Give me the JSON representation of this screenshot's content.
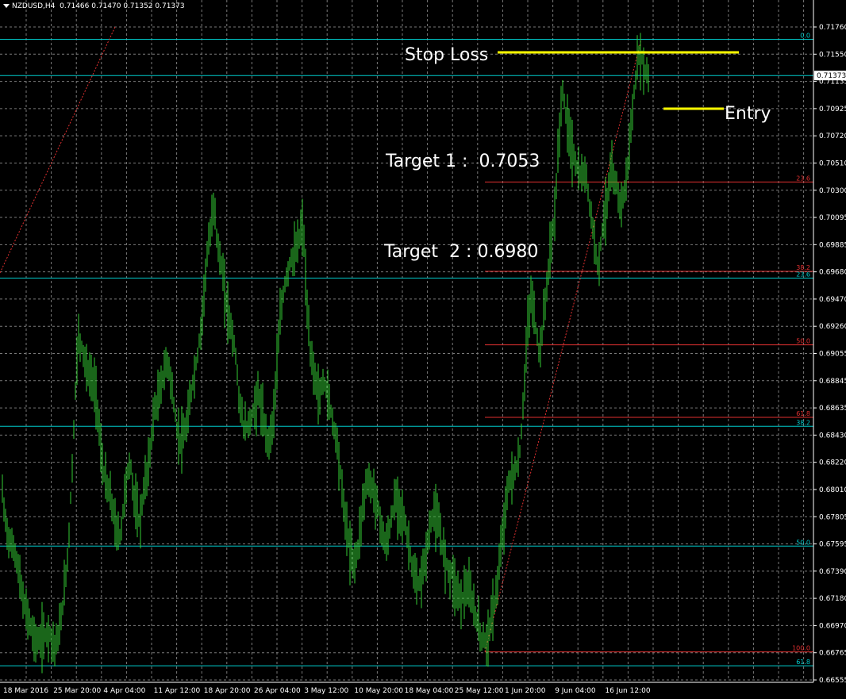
{
  "window": {
    "symbol_label": "NZDUSD,H4",
    "ohlc_label": "0.71466 0.71470 0.71352 0.71373"
  },
  "colors": {
    "background": "#000000",
    "grid": "#7a7a7a",
    "candles": "#33cc33",
    "axis_text": "#ffffff",
    "fib_cyan": "#00cccc",
    "fib_red": "#e03030",
    "annotation_yellow": "#ffff00",
    "current_price_box": "#ffffff"
  },
  "chart_data": {
    "type": "candlestick",
    "symbol": "NZDUSD",
    "timeframe": "H4",
    "last": {
      "open": 0.71466,
      "high": 0.7147,
      "low": 0.71352,
      "close": 0.71373
    },
    "ylim": [
      0.66555,
      0.71865
    ],
    "y_ticks": [
      "0.71760",
      "0.71550",
      "0.71373",
      "0.71135",
      "0.70925",
      "0.70720",
      "0.70510",
      "0.70300",
      "0.70095",
      "0.69885",
      "0.69680",
      "0.69470",
      "0.69260",
      "0.69055",
      "0.68845",
      "0.68635",
      "0.68430",
      "0.68220",
      "0.68010",
      "0.67805",
      "0.67595",
      "0.67390",
      "0.67180",
      "0.66970",
      "0.66765",
      "0.66555"
    ],
    "x_ticks": [
      "18 Mar 2016",
      "25 Mar 20:00",
      "4 Apr 04:00",
      "11 Apr 12:00",
      "18 Apr 20:00",
      "26 Apr 04:00",
      "3 May 12:00",
      "10 May 20:00",
      "18 May 04:00",
      "25 May 12:00",
      "1 Jun 20:00",
      "9 Jun 04:00",
      "16 Jun 12:00"
    ],
    "price_path": [
      [
        0,
        0.6825
      ],
      [
        6,
        0.6785
      ],
      [
        12,
        0.6765
      ],
      [
        18,
        0.676
      ],
      [
        24,
        0.674
      ],
      [
        30,
        0.6715
      ],
      [
        36,
        0.6705
      ],
      [
        42,
        0.669
      ],
      [
        48,
        0.6685
      ],
      [
        55,
        0.669
      ],
      [
        62,
        0.6695
      ],
      [
        68,
        0.6682
      ],
      [
        74,
        0.669
      ],
      [
        80,
        0.672
      ],
      [
        86,
        0.676
      ],
      [
        92,
        0.684
      ],
      [
        98,
        0.693
      ],
      [
        104,
        0.692
      ],
      [
        110,
        0.69
      ],
      [
        116,
        0.6895
      ],
      [
        122,
        0.688
      ],
      [
        128,
        0.683
      ],
      [
        134,
        0.681
      ],
      [
        140,
        0.68
      ],
      [
        146,
        0.6775
      ],
      [
        152,
        0.677
      ],
      [
        158,
        0.681
      ],
      [
        164,
        0.683
      ],
      [
        170,
        0.6795
      ],
      [
        176,
        0.678
      ],
      [
        182,
        0.681
      ],
      [
        188,
        0.683
      ],
      [
        194,
        0.687
      ],
      [
        200,
        0.688
      ],
      [
        206,
        0.69
      ],
      [
        212,
        0.691
      ],
      [
        218,
        0.688
      ],
      [
        224,
        0.685
      ],
      [
        230,
        0.6845
      ],
      [
        236,
        0.686
      ],
      [
        242,
        0.689
      ],
      [
        248,
        0.691
      ],
      [
        254,
        0.694
      ],
      [
        260,
        0.699
      ],
      [
        266,
        0.7015
      ],
      [
        270,
        0.704
      ],
      [
        274,
        0.7
      ],
      [
        278,
        0.699
      ],
      [
        284,
        0.696
      ],
      [
        290,
        0.694
      ],
      [
        296,
        0.692
      ],
      [
        302,
        0.6875
      ],
      [
        308,
        0.6855
      ],
      [
        314,
        0.686
      ],
      [
        320,
        0.687
      ],
      [
        326,
        0.6885
      ],
      [
        332,
        0.686
      ],
      [
        338,
        0.6845
      ],
      [
        344,
        0.686
      ],
      [
        348,
        0.69
      ],
      [
        354,
        0.695
      ],
      [
        360,
        0.6975
      ],
      [
        366,
        0.699
      ],
      [
        372,
        0.6995
      ],
      [
        378,
        0.701
      ],
      [
        382,
        0.702
      ],
      [
        386,
        0.696
      ],
      [
        390,
        0.692
      ],
      [
        396,
        0.69
      ],
      [
        402,
        0.688
      ],
      [
        408,
        0.6895
      ],
      [
        414,
        0.688
      ],
      [
        420,
        0.686
      ],
      [
        426,
        0.684
      ],
      [
        432,
        0.68
      ],
      [
        438,
        0.677
      ],
      [
        444,
        0.675
      ],
      [
        450,
        0.6755
      ],
      [
        456,
        0.679
      ],
      [
        462,
        0.6815
      ],
      [
        468,
        0.681
      ],
      [
        474,
        0.68
      ],
      [
        480,
        0.678
      ],
      [
        486,
        0.676
      ],
      [
        492,
        0.678
      ],
      [
        498,
        0.68
      ],
      [
        504,
        0.6795
      ],
      [
        510,
        0.678
      ],
      [
        516,
        0.676
      ],
      [
        522,
        0.6735
      ],
      [
        528,
        0.673
      ],
      [
        534,
        0.6745
      ],
      [
        540,
        0.677
      ],
      [
        546,
        0.679
      ],
      [
        552,
        0.678
      ],
      [
        558,
        0.676
      ],
      [
        564,
        0.6745
      ],
      [
        570,
        0.674
      ],
      [
        576,
        0.6725
      ],
      [
        582,
        0.672
      ],
      [
        588,
        0.673
      ],
      [
        594,
        0.672
      ],
      [
        600,
        0.6705
      ],
      [
        606,
        0.669
      ],
      [
        612,
        0.6685
      ],
      [
        618,
        0.67
      ],
      [
        624,
        0.672
      ],
      [
        630,
        0.675
      ],
      [
        636,
        0.679
      ],
      [
        642,
        0.6815
      ],
      [
        648,
        0.682
      ],
      [
        654,
        0.683
      ],
      [
        658,
        0.686
      ],
      [
        662,
        0.691
      ],
      [
        668,
        0.696
      ],
      [
        672,
        0.6955
      ],
      [
        676,
        0.693
      ],
      [
        680,
        0.6915
      ],
      [
        686,
        0.695
      ],
      [
        692,
        0.699
      ],
      [
        698,
        0.702
      ],
      [
        704,
        0.708
      ],
      [
        708,
        0.713
      ],
      [
        712,
        0.711
      ],
      [
        716,
        0.7095
      ],
      [
        720,
        0.708
      ],
      [
        726,
        0.7065
      ],
      [
        732,
        0.7055
      ],
      [
        738,
        0.706
      ],
      [
        742,
        0.704
      ],
      [
        746,
        0.702
      ],
      [
        750,
        0.7
      ],
      [
        754,
        0.6985
      ],
      [
        758,
        0.701
      ],
      [
        764,
        0.7035
      ],
      [
        770,
        0.706
      ],
      [
        776,
        0.705
      ],
      [
        782,
        0.7035
      ],
      [
        788,
        0.7045
      ],
      [
        792,
        0.7075
      ],
      [
        796,
        0.71
      ],
      [
        800,
        0.713
      ],
      [
        804,
        0.715
      ],
      [
        808,
        0.7155
      ],
      [
        812,
        0.714
      ],
      [
        816,
        0.714
      ],
      [
        818,
        0.7137
      ]
    ],
    "fib_red": {
      "x_start": 611,
      "levels": [
        {
          "label": "23.6",
          "price": 0.70524
        },
        {
          "label": "38.2",
          "price": 0.69812
        },
        {
          "label": "50.0",
          "price": 0.69226
        },
        {
          "label": "61.8",
          "price": 0.68648
        },
        {
          "label": "100.0",
          "price": 0.66779
        }
      ]
    },
    "fib_cyan": {
      "x_start": 0,
      "levels": [
        {
          "label": "0.0",
          "price": 0.71662
        },
        {
          "label": "23.6",
          "price": 0.69758
        },
        {
          "label": "38.2",
          "price": 0.68577
        },
        {
          "label": "50.0",
          "price": 0.67622
        },
        {
          "label": "61.8",
          "price": 0.66668
        }
      ]
    },
    "current_price_line": 0.71373,
    "trend_lines": [
      {
        "from": [
          0,
          0.698
        ],
        "to": [
          145,
          0.7176
        ]
      },
      {
        "from": [
          611,
          0.6678
        ],
        "to": [
          808,
          0.7166
        ]
      }
    ],
    "annotations": {
      "stop_loss": {
        "text": "Stop Loss",
        "price": 0.7158
      },
      "entry": {
        "text": "Entry",
        "price": 0.71235
      },
      "target1": {
        "text": "Target 1 :  0.7053"
      },
      "target2": {
        "text": "Target  2 : 0.6980"
      }
    }
  }
}
